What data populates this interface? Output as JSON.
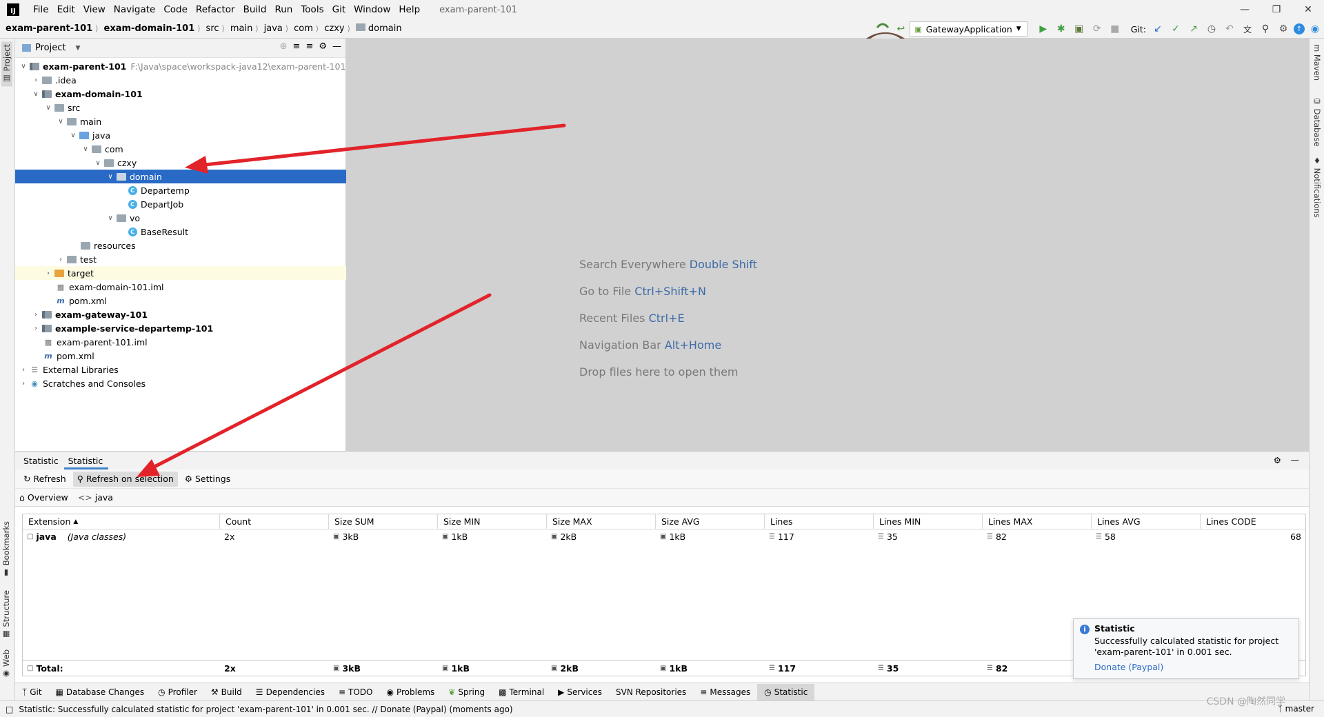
{
  "app": {
    "logo": "IJ",
    "title": "exam-parent-101"
  },
  "menu": [
    "File",
    "Edit",
    "View",
    "Navigate",
    "Code",
    "Refactor",
    "Build",
    "Run",
    "Tools",
    "Git",
    "Window",
    "Help"
  ],
  "breadcrumbs": [
    "exam-parent-101",
    "exam-domain-101",
    "src",
    "main",
    "java",
    "com",
    "czxy",
    "domain"
  ],
  "toolbar": {
    "run_config": "GatewayApplication",
    "git_label": "Git:"
  },
  "project_panel": {
    "title": "Project"
  },
  "tree": [
    {
      "label": "exam-parent-101",
      "hint": "F:\\Java\\space\\workspack-java12\\exam-parent-101",
      "bold": true
    },
    {
      "label": ".idea"
    },
    {
      "label": "exam-domain-101",
      "bold": true
    },
    {
      "label": "src"
    },
    {
      "label": "main"
    },
    {
      "label": "java"
    },
    {
      "label": "com"
    },
    {
      "label": "czxy"
    },
    {
      "label": "domain"
    },
    {
      "label": "Departemp"
    },
    {
      "label": "DepartJob"
    },
    {
      "label": "vo"
    },
    {
      "label": "BaseResult"
    },
    {
      "label": "resources"
    },
    {
      "label": "test"
    },
    {
      "label": "target"
    },
    {
      "label": "exam-domain-101.iml"
    },
    {
      "label": "pom.xml"
    },
    {
      "label": "exam-gateway-101",
      "bold": true
    },
    {
      "label": "example-service-departemp-101",
      "bold": true
    },
    {
      "label": "exam-parent-101.iml"
    },
    {
      "label": "pom.xml"
    },
    {
      "label": "External Libraries"
    },
    {
      "label": "Scratches and Consoles"
    }
  ],
  "editor_hints": [
    {
      "text": "Search Everywhere",
      "key": "Double Shift"
    },
    {
      "text": "Go to File",
      "key": "Ctrl+Shift+N"
    },
    {
      "text": "Recent Files",
      "key": "Ctrl+E"
    },
    {
      "text": "Navigation Bar",
      "key": "Alt+Home"
    },
    {
      "text": "Drop files here to open them",
      "key": ""
    }
  ],
  "bottom_tabs": [
    "Statistic",
    "Statistic"
  ],
  "stat_toolbar": {
    "refresh": "Refresh",
    "refresh_on_selection": "Refresh on selection",
    "settings": "Settings"
  },
  "stat_tabs": {
    "overview": "Overview",
    "java": "java"
  },
  "table": {
    "headers": [
      "Extension",
      "Count",
      "Size SUM",
      "Size MIN",
      "Size MAX",
      "Size AVG",
      "Lines",
      "Lines MIN",
      "Lines MAX",
      "Lines AVG",
      "Lines CODE"
    ],
    "row": {
      "ext": "java",
      "ext_desc": "(Java classes)",
      "count": "2x",
      "size_sum": "3kB",
      "size_min": "1kB",
      "size_max": "2kB",
      "size_avg": "1kB",
      "lines": "117",
      "lines_min": "35",
      "lines_max": "82",
      "lines_avg": "58",
      "lines_code": "68"
    },
    "total": {
      "label": "Total:",
      "count": "2x",
      "size_sum": "3kB",
      "size_min": "1kB",
      "size_max": "2kB",
      "size_avg": "1kB",
      "lines": "117",
      "lines_min": "35",
      "lines_max": "82"
    }
  },
  "notification": {
    "title": "Statistic",
    "body": "Successfully calculated statistic for project 'exam-parent-101' in 0.001 sec.",
    "link": "Donate (Paypal)"
  },
  "left_stripe": {
    "project": "Project",
    "bookmarks": "Bookmarks",
    "structure": "Structure",
    "web": "Web"
  },
  "right_stripe": {
    "maven": "Maven",
    "database": "Database",
    "notifications": "Notifications"
  },
  "tool_windows": [
    "Git",
    "Database Changes",
    "Profiler",
    "Build",
    "Dependencies",
    "TODO",
    "Problems",
    "Spring",
    "Terminal",
    "Services",
    "SVN Repositories",
    "Messages",
    "Statistic"
  ],
  "status": {
    "message": "Statistic: Successfully calculated statistic for project 'exam-parent-101' in 0.001 sec. // Donate (Paypal) (moments ago)",
    "branch": "master"
  },
  "watermark": "CSDN @陶然同学",
  "colors": {
    "selection": "#2a6ac7",
    "arrow": "#e2232a",
    "link": "#2d6bc7"
  }
}
